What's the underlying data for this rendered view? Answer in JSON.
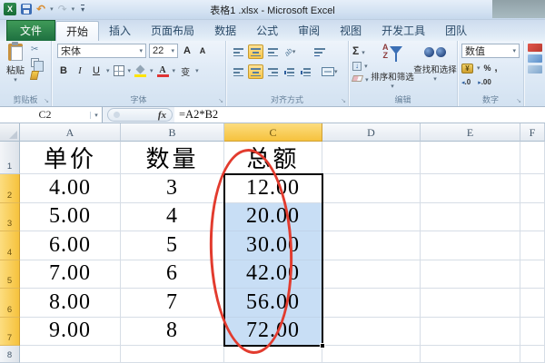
{
  "titlebar": {
    "title": "表格1 .xlsx - Microsoft Excel"
  },
  "icons": {
    "excel_logo_letter": "X",
    "undo": "↶",
    "redo": "↷",
    "dropdown_arrow": "▾",
    "launcher_arrow": "↘",
    "scissors": "✂",
    "sigma": "Σ",
    "filldown_arrow": "↓",
    "letter_a_big": "A",
    "letter_a_small": "A",
    "orientation": "ab",
    "accounting": "¥",
    "sort_az": "AZ"
  },
  "tabs": [
    {
      "id": "file",
      "label": "文件",
      "file": true
    },
    {
      "id": "home",
      "label": "开始",
      "active": true
    },
    {
      "id": "insert",
      "label": "插入"
    },
    {
      "id": "page-layout",
      "label": "页面布局"
    },
    {
      "id": "data",
      "label": "数据"
    },
    {
      "id": "formulas",
      "label": "公式"
    },
    {
      "id": "review",
      "label": "审阅"
    },
    {
      "id": "view",
      "label": "视图"
    },
    {
      "id": "developer",
      "label": "开发工具"
    },
    {
      "id": "team",
      "label": "团队"
    }
  ],
  "ribbon": {
    "clipboard": {
      "group_label": "剪贴板",
      "paste_label": "粘贴"
    },
    "font": {
      "group_label": "字体",
      "font_name": "宋体",
      "font_size": "22",
      "bold": "B",
      "italic": "I",
      "underline": "U",
      "phonetic": "变"
    },
    "alignment": {
      "group_label": "对齐方式"
    },
    "editing": {
      "group_label": "编辑",
      "sort_filter_label": "排序和筛选",
      "find_select_label": "查找和选择"
    },
    "number": {
      "group_label": "数字",
      "format_value": "数值",
      "percent": "%",
      "comma": ",",
      "increase_decimal": ".0",
      "decrease_decimal": ".00"
    }
  },
  "formula_bar": {
    "name_box": "C2",
    "fx_label": "fx",
    "formula": "=A2*B2"
  },
  "sheet": {
    "column_headers": [
      "A",
      "B",
      "C",
      "D",
      "E",
      "F"
    ],
    "selection": {
      "range": "C2:C7",
      "active_cell": "C2",
      "selected_column": "C",
      "selected_rows": [
        "2",
        "3",
        "4",
        "5",
        "6",
        "7"
      ]
    },
    "rows": [
      {
        "num": "1",
        "cells": [
          "单价",
          "数量",
          "总额",
          "",
          "",
          ""
        ]
      },
      {
        "num": "2",
        "cells": [
          "4.00",
          "3",
          "12.00",
          "",
          "",
          ""
        ]
      },
      {
        "num": "3",
        "cells": [
          "5.00",
          "4",
          "20.00",
          "",
          "",
          ""
        ]
      },
      {
        "num": "4",
        "cells": [
          "6.00",
          "5",
          "30.00",
          "",
          "",
          ""
        ]
      },
      {
        "num": "5",
        "cells": [
          "7.00",
          "6",
          "42.00",
          "",
          "",
          ""
        ]
      },
      {
        "num": "6",
        "cells": [
          "8.00",
          "7",
          "56.00",
          "",
          "",
          ""
        ]
      },
      {
        "num": "7",
        "cells": [
          "9.00",
          "8",
          "72.00",
          "",
          "",
          ""
        ]
      },
      {
        "num": "8",
        "cells": [
          "",
          "",
          "",
          "",
          "",
          ""
        ]
      }
    ]
  },
  "annotation": {
    "shape": "ellipse",
    "color": "#e23b2e",
    "target": "C2:C7"
  }
}
